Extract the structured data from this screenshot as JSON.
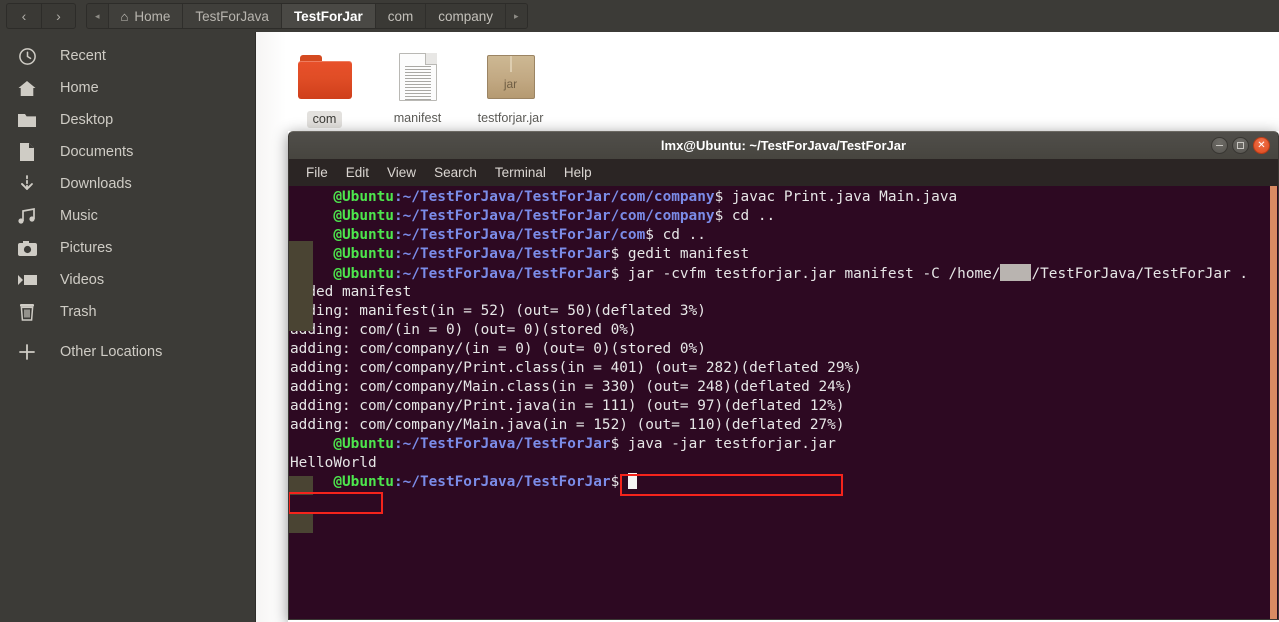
{
  "window": {
    "app": "file-manager",
    "nav": {
      "back": "‹",
      "forward": "›"
    },
    "breadcrumb_prev_arrow": "◂",
    "breadcrumb_next_arrow": "▸",
    "breadcrumbs": [
      {
        "label": "Home",
        "icon": "home-icon",
        "state": "dim"
      },
      {
        "label": "TestForJava",
        "state": "dim"
      },
      {
        "label": "TestForJar",
        "state": "active"
      },
      {
        "label": "com",
        "state": "dim"
      },
      {
        "label": "company",
        "state": "dim"
      }
    ]
  },
  "sidebar": {
    "items": [
      {
        "label": "Recent",
        "icon": "clock-icon"
      },
      {
        "label": "Home",
        "icon": "home-icon"
      },
      {
        "label": "Desktop",
        "icon": "folder-icon"
      },
      {
        "label": "Documents",
        "icon": "document-icon"
      },
      {
        "label": "Downloads",
        "icon": "download-icon"
      },
      {
        "label": "Music",
        "icon": "music-note-icon"
      },
      {
        "label": "Pictures",
        "icon": "camera-icon"
      },
      {
        "label": "Videos",
        "icon": "video-icon"
      },
      {
        "label": "Trash",
        "icon": "trash-icon"
      },
      {
        "label": "Other Locations",
        "icon": "plus-icon"
      }
    ]
  },
  "files": [
    {
      "name": "com",
      "type": "folder",
      "selected": true
    },
    {
      "name": "manifest",
      "type": "document",
      "selected": false
    },
    {
      "name": "testforjar.jar",
      "type": "jar",
      "badge": "jar",
      "selected": false
    }
  ],
  "terminal": {
    "title": "lmx@Ubuntu: ~/TestForJava/TestForJar",
    "window_buttons": {
      "minimize": "minimize-button",
      "maximize": "maximize-button",
      "close": "close-button"
    },
    "menu": [
      "File",
      "Edit",
      "View",
      "Search",
      "Terminal",
      "Help"
    ],
    "lines": [
      {
        "type": "prompt",
        "redacted_user": true,
        "host": "@Ubuntu",
        "path": ":~/TestForJava/TestForJar/com/company",
        "dollar": "$ ",
        "cmd": "javac Print.java Main.java"
      },
      {
        "type": "prompt",
        "redacted_user": true,
        "host": "@Ubuntu",
        "path": ":~/TestForJava/TestForJar/com/company",
        "dollar": "$ ",
        "cmd": "cd .."
      },
      {
        "type": "prompt",
        "redacted_user": true,
        "host": "@Ubuntu",
        "path": ":~/TestForJava/TestForJar/com",
        "dollar": "$ ",
        "cmd": "cd .."
      },
      {
        "type": "prompt",
        "redacted_user": true,
        "host": "@Ubuntu",
        "path": ":~/TestForJava/TestForJar",
        "dollar": "$ ",
        "cmd": "gedit manifest"
      },
      {
        "type": "prompt_redact_inline",
        "redacted_user": true,
        "host": "@Ubuntu",
        "path": ":~/TestForJava/TestForJar",
        "dollar": "$ ",
        "cmd_a": "jar -cvfm testforjar.jar manifest -C /home/",
        "cmd_b": "/TestForJava/TestForJar ."
      },
      {
        "type": "out",
        "text": "added manifest"
      },
      {
        "type": "out",
        "text": "adding: manifest(in = 52) (out= 50)(deflated 3%)"
      },
      {
        "type": "out",
        "text": "adding: com/(in = 0) (out= 0)(stored 0%)"
      },
      {
        "type": "out",
        "text": "adding: com/company/(in = 0) (out= 0)(stored 0%)"
      },
      {
        "type": "out",
        "text": "adding: com/company/Print.class(in = 401) (out= 282)(deflated 29%)"
      },
      {
        "type": "out",
        "text": "adding: com/company/Main.class(in = 330) (out= 248)(deflated 24%)"
      },
      {
        "type": "out",
        "text": "adding: com/company/Print.java(in = 111) (out= 97)(deflated 12%)"
      },
      {
        "type": "out",
        "text": "adding: com/company/Main.java(in = 152) (out= 110)(deflated 27%)"
      },
      {
        "type": "prompt",
        "redacted_user": true,
        "host": "@Ubuntu",
        "path": ":~/TestForJava/TestForJar",
        "dollar": "$ ",
        "cmd": "java -jar testforjar.jar"
      },
      {
        "type": "out",
        "text": "HelloWorld"
      },
      {
        "type": "prompt_cursor",
        "redacted_user": true,
        "host": "@Ubuntu",
        "path": ":~/TestForJava/TestForJar",
        "dollar": "$ ",
        "cmd": ""
      }
    ],
    "annotations": [
      {
        "name": "highlight-java-jar-command",
        "target": "java -jar testforjar.jar"
      },
      {
        "name": "highlight-helloworld-output",
        "target": "HelloWorld"
      }
    ]
  },
  "colors": {
    "annotation_red": "#f4241c",
    "terminal_bg": "#2d0922",
    "prompt_user_green": "#4de64d",
    "prompt_path_blue": "#7b8ce8",
    "folder_orange": "#e04d26",
    "scrollbar": "#d98b63"
  }
}
